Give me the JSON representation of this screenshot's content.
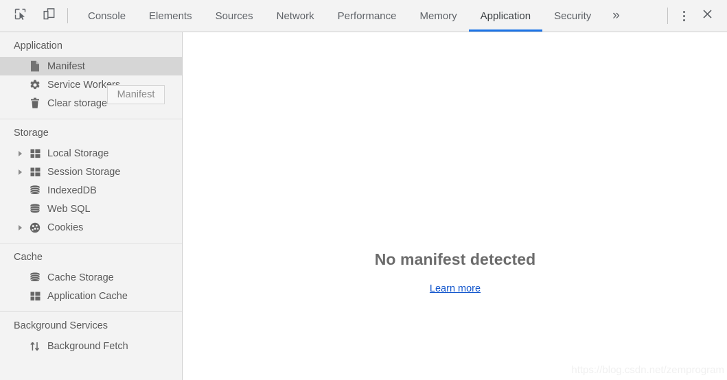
{
  "toolbar": {
    "inspect_icon": "inspect-element-icon",
    "device_icon": "device-toolbar-icon",
    "tabs": [
      {
        "label": "Console",
        "active": false
      },
      {
        "label": "Elements",
        "active": false
      },
      {
        "label": "Sources",
        "active": false
      },
      {
        "label": "Network",
        "active": false
      },
      {
        "label": "Performance",
        "active": false
      },
      {
        "label": "Memory",
        "active": false
      },
      {
        "label": "Application",
        "active": true
      },
      {
        "label": "Security",
        "active": false
      }
    ],
    "more_tabs_label": "»",
    "menu_icon": "more-vertical-icon",
    "close_label": "✕",
    "active_tab_color": "#1a73e8"
  },
  "sidebar": {
    "sections": [
      {
        "title": "Application",
        "items": [
          {
            "label": "Manifest",
            "icon": "document-icon",
            "selected": true,
            "expandable": false
          },
          {
            "label": "Service Workers",
            "icon": "gear-icon",
            "selected": false,
            "expandable": false
          },
          {
            "label": "Clear storage",
            "icon": "trash-icon",
            "selected": false,
            "expandable": false
          }
        ]
      },
      {
        "title": "Storage",
        "items": [
          {
            "label": "Local Storage",
            "icon": "table-icon",
            "selected": false,
            "expandable": true
          },
          {
            "label": "Session Storage",
            "icon": "table-icon",
            "selected": false,
            "expandable": true
          },
          {
            "label": "IndexedDB",
            "icon": "database-icon",
            "selected": false,
            "expandable": false
          },
          {
            "label": "Web SQL",
            "icon": "database-icon",
            "selected": false,
            "expandable": false
          },
          {
            "label": "Cookies",
            "icon": "cookie-icon",
            "selected": false,
            "expandable": true
          }
        ]
      },
      {
        "title": "Cache",
        "items": [
          {
            "label": "Cache Storage",
            "icon": "database-icon",
            "selected": false,
            "expandable": false
          },
          {
            "label": "Application Cache",
            "icon": "table-icon",
            "selected": false,
            "expandable": false
          }
        ]
      },
      {
        "title": "Background Services",
        "items": [
          {
            "label": "Background Fetch",
            "icon": "updown-arrows-icon",
            "selected": false,
            "expandable": false
          }
        ]
      }
    ]
  },
  "tooltip": {
    "text": "Manifest"
  },
  "main": {
    "empty_title": "No manifest detected",
    "learn_more_label": "Learn more",
    "link_color": "#1155cc"
  },
  "watermark": {
    "text": "https://blog.csdn.net/zemprogram"
  }
}
